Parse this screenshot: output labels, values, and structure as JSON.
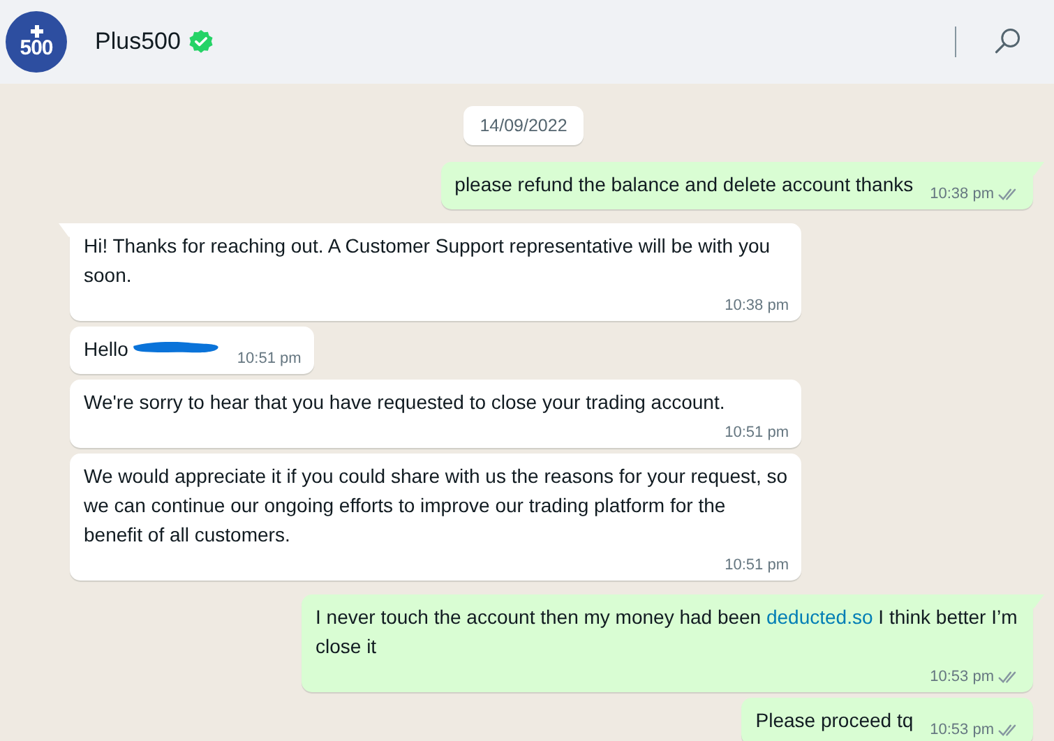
{
  "header": {
    "avatar_text": "500",
    "name": "Plus500",
    "verified": true
  },
  "date": "14/09/2022",
  "messages": [
    {
      "outgoing": true,
      "tail": true,
      "parts": [
        {
          "kind": "text",
          "text": "please refund the balance and delete account thanks"
        }
      ],
      "time": "10:38 pm",
      "delivered": true
    },
    {
      "outgoing": false,
      "tail": true,
      "parts": [
        {
          "kind": "text",
          "text": "Hi! Thanks for reaching out. A Customer Support representative will be with you soon."
        }
      ],
      "time": "10:38 pm"
    },
    {
      "outgoing": false,
      "tail": false,
      "parts": [
        {
          "kind": "text",
          "text": "Hello"
        },
        {
          "kind": "redacted"
        }
      ],
      "time": "10:51 pm"
    },
    {
      "outgoing": false,
      "tail": false,
      "parts": [
        {
          "kind": "text",
          "text": "We're sorry to hear that you have requested to close your trading account."
        }
      ],
      "time": "10:51 pm"
    },
    {
      "outgoing": false,
      "tail": false,
      "parts": [
        {
          "kind": "text",
          "text": "We would appreciate it if you could share with us the reasons for your request, so we can continue our ongoing efforts to improve our trading platform for the benefit of all customers."
        }
      ],
      "time": "10:51 pm"
    },
    {
      "outgoing": true,
      "tail": true,
      "parts": [
        {
          "kind": "text",
          "text": "I never touch the account then my money had been "
        },
        {
          "kind": "link",
          "text": "deducted.so"
        },
        {
          "kind": "text",
          "text": " I think better I’m close it"
        }
      ],
      "time": "10:53 pm",
      "delivered": true
    },
    {
      "outgoing": true,
      "tail": false,
      "parts": [
        {
          "kind": "text",
          "text": "Please proceed tq"
        }
      ],
      "time": "10:53 pm",
      "delivered": true
    }
  ]
}
